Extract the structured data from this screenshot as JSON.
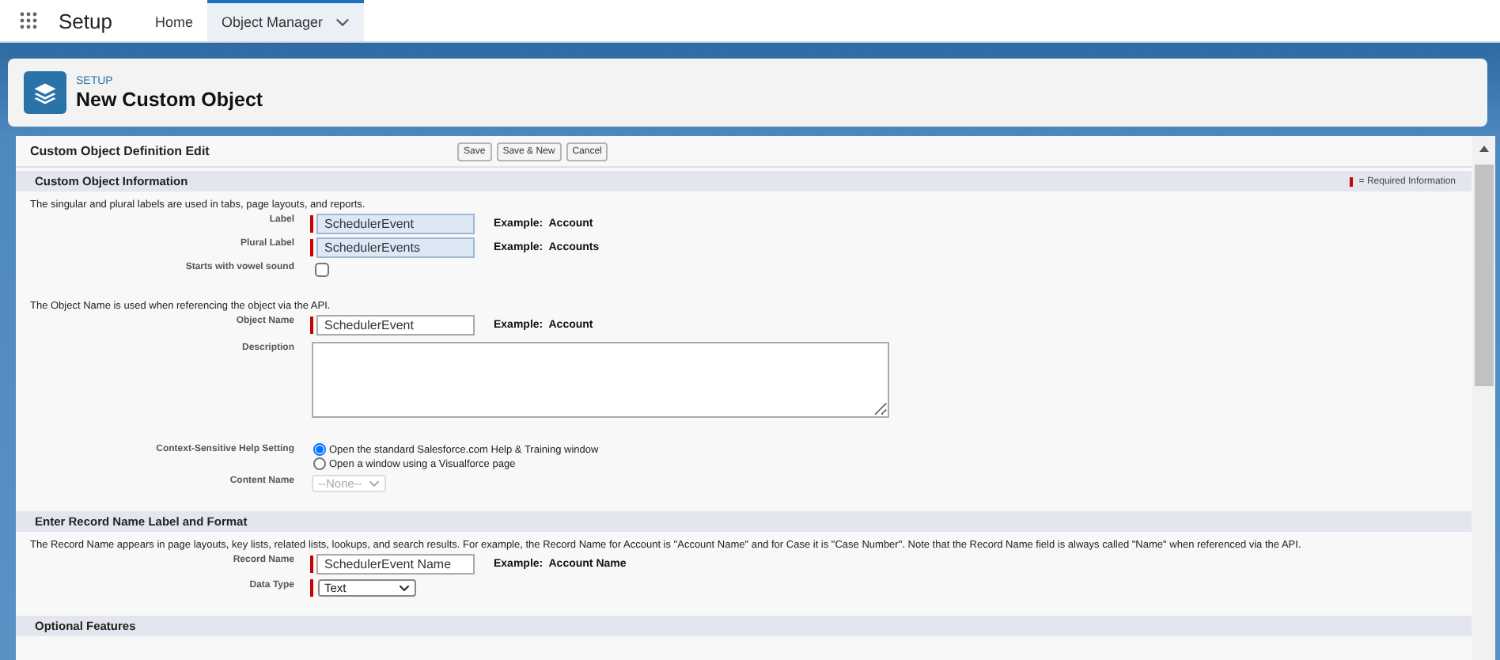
{
  "nav": {
    "app_name": "Setup",
    "tabs": [
      {
        "label": "Home",
        "selected": false,
        "has_menu": false
      },
      {
        "label": "Object Manager",
        "selected": true,
        "has_menu": true
      }
    ]
  },
  "header": {
    "breadcrumb": "SETUP",
    "title": "New Custom Object"
  },
  "form": {
    "title": "Custom Object Definition Edit",
    "buttons": [
      "Save",
      "Save & New",
      "Cancel"
    ],
    "sections": [
      {
        "title": "Custom Object Information",
        "legend": "= Required Information",
        "rows": [
          {
            "kind": "note",
            "text": "The singular and plural labels are used in tabs, page layouts, and reports."
          },
          {
            "kind": "text",
            "label": "Label",
            "value": "SchedulerEvent",
            "required": true,
            "highlighted": true,
            "example": "Example:  Account"
          },
          {
            "kind": "text",
            "label": "Plural Label",
            "value": "SchedulerEvents",
            "required": true,
            "highlighted": true,
            "example": "Example:  Accounts"
          },
          {
            "kind": "checkbox",
            "label": "Starts with vowel sound",
            "checked": false
          },
          {
            "kind": "note",
            "text": "The Object Name is used when referencing the object via the API."
          },
          {
            "kind": "text",
            "label": "Object Name",
            "value": "SchedulerEvent",
            "required": true,
            "highlighted": false,
            "example": "Example:  Account"
          },
          {
            "kind": "textarea",
            "label": "Description"
          },
          {
            "kind": "radios",
            "label": "Context-Sensitive Help Setting",
            "options": [
              {
                "label": "Open the standard Salesforce.com Help & Training window",
                "selected": true
              },
              {
                "label": "Open a window using a Visualforce page",
                "selected": false
              }
            ]
          },
          {
            "kind": "select",
            "label": "Content Name",
            "value": "--None--",
            "required": false,
            "disabled": true
          }
        ]
      },
      {
        "title": "Enter Record Name Label and Format",
        "rows": [
          {
            "kind": "note",
            "text": "The Record Name appears in page layouts, key lists, related lists, lookups, and search results. For example, the Record Name for Account is \"Account Name\" and for Case it is \"Case Number\". Note that the Record Name field is always called \"Name\" when referenced via the API."
          },
          {
            "kind": "text",
            "label": "Record Name",
            "value": "SchedulerEvent Name",
            "required": true,
            "highlighted": false,
            "example": "Example:  Account Name"
          },
          {
            "kind": "select",
            "label": "Data Type",
            "value": "Text",
            "required": true,
            "disabled": false
          }
        ]
      },
      {
        "title": "Optional Features"
      }
    ]
  }
}
